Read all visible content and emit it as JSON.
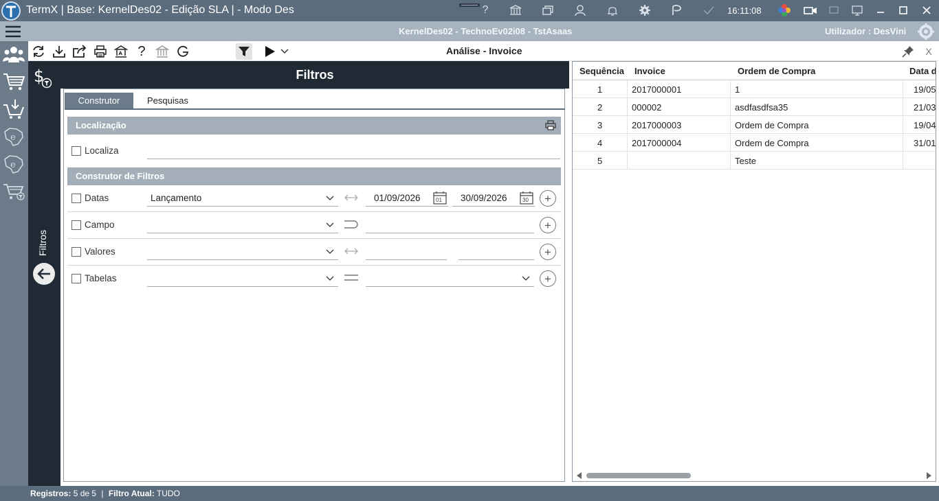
{
  "titlebar": {
    "title": "TermX | Base: KernelDes02 - Edição SLA | - Modo Des",
    "clock": "16:11:08"
  },
  "infobar": {
    "context": "KernelDes02 - TechnoEv02i08 - TstAsaas",
    "user_label": "Utilizador :",
    "user_name": "DesVini"
  },
  "toolbar": {
    "page_title": "Análise - Invoice",
    "close_label": "X"
  },
  "filter": {
    "header": "Filtros",
    "rail_label": "Filtros",
    "tabs": [
      "Construtor",
      "Pesquisas"
    ],
    "localizacao": {
      "title": "Localização",
      "localiza_label": "Localiza"
    },
    "construtor": {
      "title": "Construtor de Filtros",
      "rows": [
        {
          "label": "Datas",
          "select": "Lançamento",
          "date_from": "01/09/2026",
          "date_to": "30/09/2026",
          "cal_from_day": "01",
          "cal_to_day": "30"
        },
        {
          "label": "Campo",
          "select": ""
        },
        {
          "label": "Valores",
          "select": ""
        },
        {
          "label": "Tabelas",
          "select": "",
          "select2": ""
        }
      ]
    }
  },
  "grid": {
    "columns": [
      "Sequência",
      "Invoice",
      "Ordem de Compra",
      "Data d"
    ],
    "rows": [
      {
        "seq": "1",
        "invoice": "2017000001",
        "ordem": "1",
        "data": "19/05"
      },
      {
        "seq": "2",
        "invoice": "000002",
        "ordem": "asdfasdfsa35",
        "data": "21/03"
      },
      {
        "seq": "3",
        "invoice": "2017000003",
        "ordem": "Ordem de Compra",
        "data": "19/04"
      },
      {
        "seq": "4",
        "invoice": "2017000004",
        "ordem": "Ordem de Compra",
        "data": "31/01"
      },
      {
        "seq": "5",
        "invoice": "",
        "ordem": "Teste",
        "data": ""
      }
    ]
  },
  "status": {
    "registros_label": "Registros:",
    "registros_value": "5 de 5",
    "separator": "|",
    "filtro_label": "Filtro Atual:",
    "filtro_value": "TUDO"
  }
}
